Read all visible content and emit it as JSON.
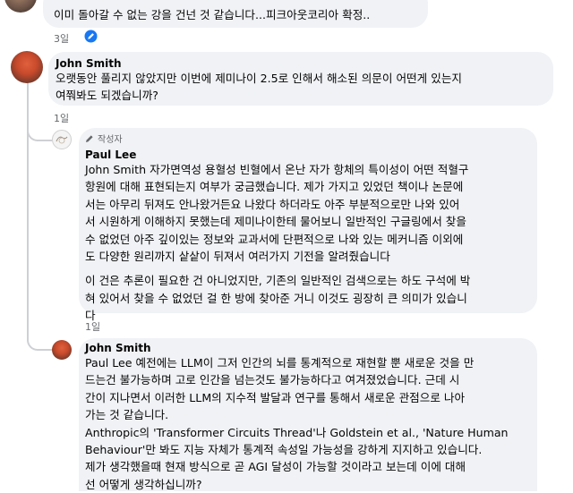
{
  "comments": [
    {
      "text_lines": [
        "이미 돌아갈 수 없는 강을 건넌 것 같습니다...피크아웃코리아 확정.."
      ],
      "time": "3일"
    },
    {
      "author": "John Smith",
      "text_lines": [
        "오랫동안 풀리지 않았지만 이번에 제미나이 2.5로 인해서 해소된 의문이 어떤게 있는지",
        "여쭤봐도 되겠습니까?"
      ],
      "time": "1일"
    },
    {
      "author": "Paul Lee",
      "badge": "작성자",
      "paragraph1_lines": [
        "John Smith 자가면역성 용혈성 빈혈에서 온난 자가 항체의 특이성이 어떤 적혈구",
        "항원에 대해 표현되는지 여부가 궁금했습니다. 제가 가지고 있었던 책이나 논문에",
        "서는 아무리 뒤져도 안나왔거든요 나왔다 하더라도 아주 부분적으로만 나와 있어",
        "서 시원하게 이해하지 못했는데 제미나이한테 물어보니 일반적인 구글링에서 찾을",
        "수 없었던 아주 깊이있는 정보와 교과서에 단편적으로 나와 있는 메커니즘 이외에",
        "도 다양한 원리까지 샅샅이 뒤져서 여러가지 기전을 알려줬습니다"
      ],
      "paragraph2_lines": [
        "이 건은 추론이 필요한 건 아니었지만, 기존의 일반적인 검색으로는 하도 구석에 박",
        "혀 있어서 찾을 수 없었던 걸 한 방에 찾아준 거니 이것도 굉장히 큰 의미가 있습니",
        "다"
      ],
      "time": "1일"
    },
    {
      "author": "John Smith",
      "text_lines": [
        "Paul Lee 예전에는 LLM이 그저 인간의 뇌를 통계적으로 재현할 뿐 새로운 것을 만",
        "드는건 불가능하며 고로 인간을 넘는것도 불가능하다고 여겨졌었습니다. 근데 시",
        "간이 지나면서 이러한 LLM의 지수적 발달과 연구를 통해서 새로운 관점으로 나아",
        "가는 것 같습니다.",
        "Anthropic의 'Transformer Circuits Thread'나 Goldstein et al., 'Nature Human",
        "Behaviour'만 봐도 지능 자체가 통계적 속성일 가능성을 강하게 지지하고 있습니다.",
        "제가 생각했을때 현재 방식으로 곧 AGI 달성이 가능할 것이라고 보는데 이에 대해",
        "선 어떻게 생각하십니까?"
      ]
    }
  ]
}
